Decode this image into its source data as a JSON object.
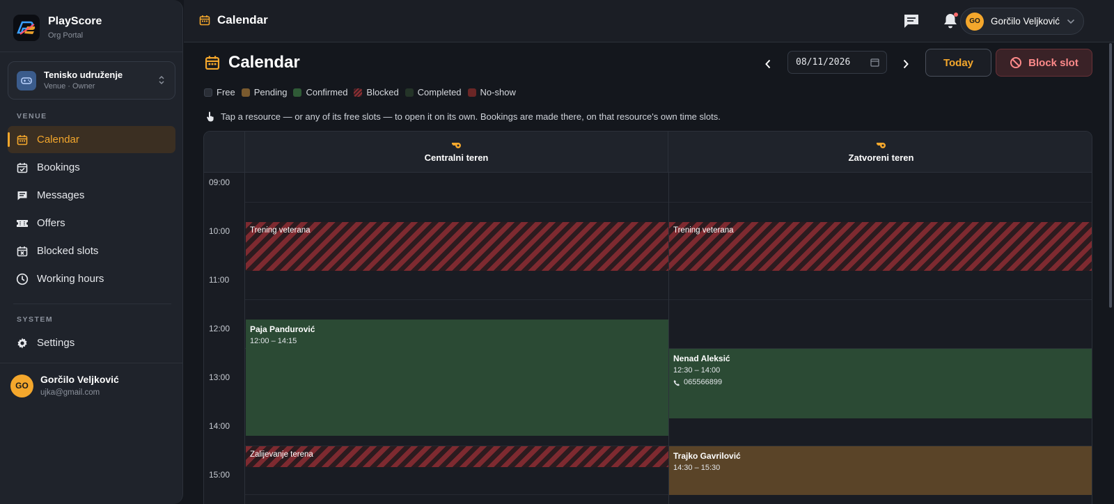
{
  "brand": {
    "name": "PlayScore",
    "subtitle": "Org Portal"
  },
  "org": {
    "name": "Tenisko udruženje",
    "role": "Venue · Owner"
  },
  "sidebar": {
    "venue_label": "VENUE",
    "system_label": "SYSTEM",
    "items": [
      {
        "label": "Calendar",
        "icon": "calendar-icon",
        "active": true
      },
      {
        "label": "Bookings",
        "icon": "calendar-check-icon"
      },
      {
        "label": "Messages",
        "icon": "message-icon"
      },
      {
        "label": "Offers",
        "icon": "ticket-icon"
      },
      {
        "label": "Blocked slots",
        "icon": "calendar-x-icon"
      },
      {
        "label": "Working hours",
        "icon": "clock-icon"
      }
    ],
    "system_items": [
      {
        "label": "Settings",
        "icon": "gear-icon"
      }
    ]
  },
  "user": {
    "initials": "GO",
    "name": "Gorčilo Veljković",
    "email": "ujka@gmail.com"
  },
  "topbar": {
    "title": "Calendar"
  },
  "page": {
    "title": "Calendar",
    "date_value": "08/11/2026",
    "today_label": "Today",
    "block_label": "Block slot",
    "hint": "Tap a resource — or any of its free slots — to open it on its own. Bookings are made there, on that resource's own time slots."
  },
  "legend": [
    "Free",
    "Pending",
    "Confirmed",
    "Blocked",
    "Completed",
    "No-show"
  ],
  "colors": {
    "accent": "#f4a72c",
    "confirmed": "#2b4a34",
    "pending": "#5a4428",
    "blocked": "#7e2a30",
    "danger": "#ff8a8a"
  },
  "calendar": {
    "times": [
      "09:00",
      "10:00",
      "11:00",
      "12:00",
      "13:00",
      "14:00",
      "15:00"
    ],
    "resources": [
      "Centralni teren",
      "Zatvoreni teren"
    ],
    "events": {
      "r1_block1": {
        "title": "Trening veterana"
      },
      "r1_booking": {
        "name": "Paja Pandurović",
        "time": "12:00 – 14:15"
      },
      "r1_block2": {
        "title": "Zalijevanje terena"
      },
      "r2_block1": {
        "title": "Trening veterana"
      },
      "r2_booking1": {
        "name": "Nenad Aleksić",
        "time": "12:30 – 14:00",
        "phone": "065566899"
      },
      "r2_booking2": {
        "name": "Trajko Gavrilović",
        "time": "14:30 – 15:30"
      }
    }
  }
}
